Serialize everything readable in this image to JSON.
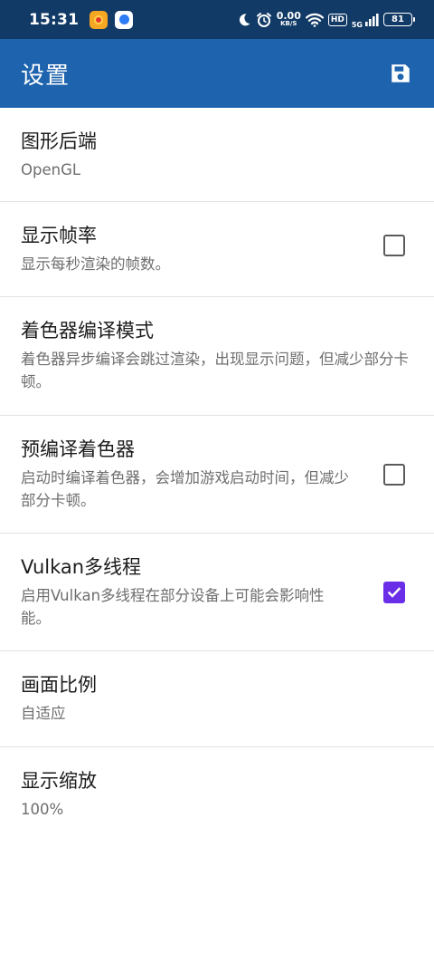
{
  "status_bar": {
    "time": "15:31",
    "net_speed_value": "0.00",
    "net_speed_unit": "KB/S",
    "hd_label": "HD",
    "network_type": "5G",
    "battery_level": "81",
    "icons": [
      "app-notification-1",
      "app-notification-2",
      "moon-icon",
      "alarm-icon",
      "wifi-icon",
      "hd-icon",
      "signal-icon",
      "battery-icon"
    ]
  },
  "app_bar": {
    "title": "设置",
    "save_icon": "save-icon"
  },
  "accent_color": "#6a2ee8",
  "app_bar_color": "#1e63ad",
  "status_bar_color": "#123a66",
  "settings": [
    {
      "title": "图形后端",
      "summary": "OpenGL"
    },
    {
      "title": "显示帧率",
      "summary": "显示每秒渲染的帧数。",
      "checked": false
    },
    {
      "title": "着色器编译模式",
      "summary": "着色器异步编译会跳过渲染，出现显示问题，但减少部分卡顿。"
    },
    {
      "title": "预编译着色器",
      "summary": "启动时编译着色器，会增加游戏启动时间，但减少部分卡顿。",
      "checked": false
    },
    {
      "title": "Vulkan多线程",
      "summary": "启用Vulkan多线程在部分设备上可能会影响性能。",
      "checked": true
    },
    {
      "title": "画面比例",
      "summary": "自适应"
    },
    {
      "title": "显示缩放",
      "summary": "100%"
    }
  ]
}
